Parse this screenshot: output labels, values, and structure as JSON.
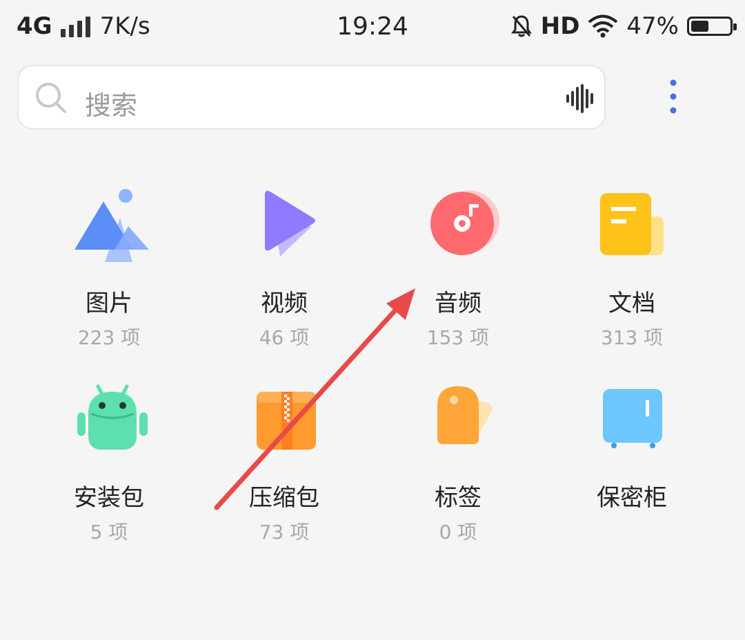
{
  "status_bar": {
    "network": "4G",
    "speed": "7K/s",
    "time": "19:24",
    "hd": "HD",
    "battery_percent": "47%",
    "battery_level": 0.47
  },
  "search": {
    "placeholder": "搜索"
  },
  "categories": [
    {
      "label": "图片",
      "count": "223 项"
    },
    {
      "label": "视频",
      "count": "46 项"
    },
    {
      "label": "音频",
      "count": "153 项"
    },
    {
      "label": "文档",
      "count": "313 项"
    },
    {
      "label": "安装包",
      "count": "5 项"
    },
    {
      "label": "压缩包",
      "count": "73 项"
    },
    {
      "label": "标签",
      "count": "0 项"
    },
    {
      "label": "保密柜",
      "count": ""
    }
  ],
  "colors": {
    "accent_blue": "#4a6fe0",
    "annotation_red": "#e84a4a"
  }
}
